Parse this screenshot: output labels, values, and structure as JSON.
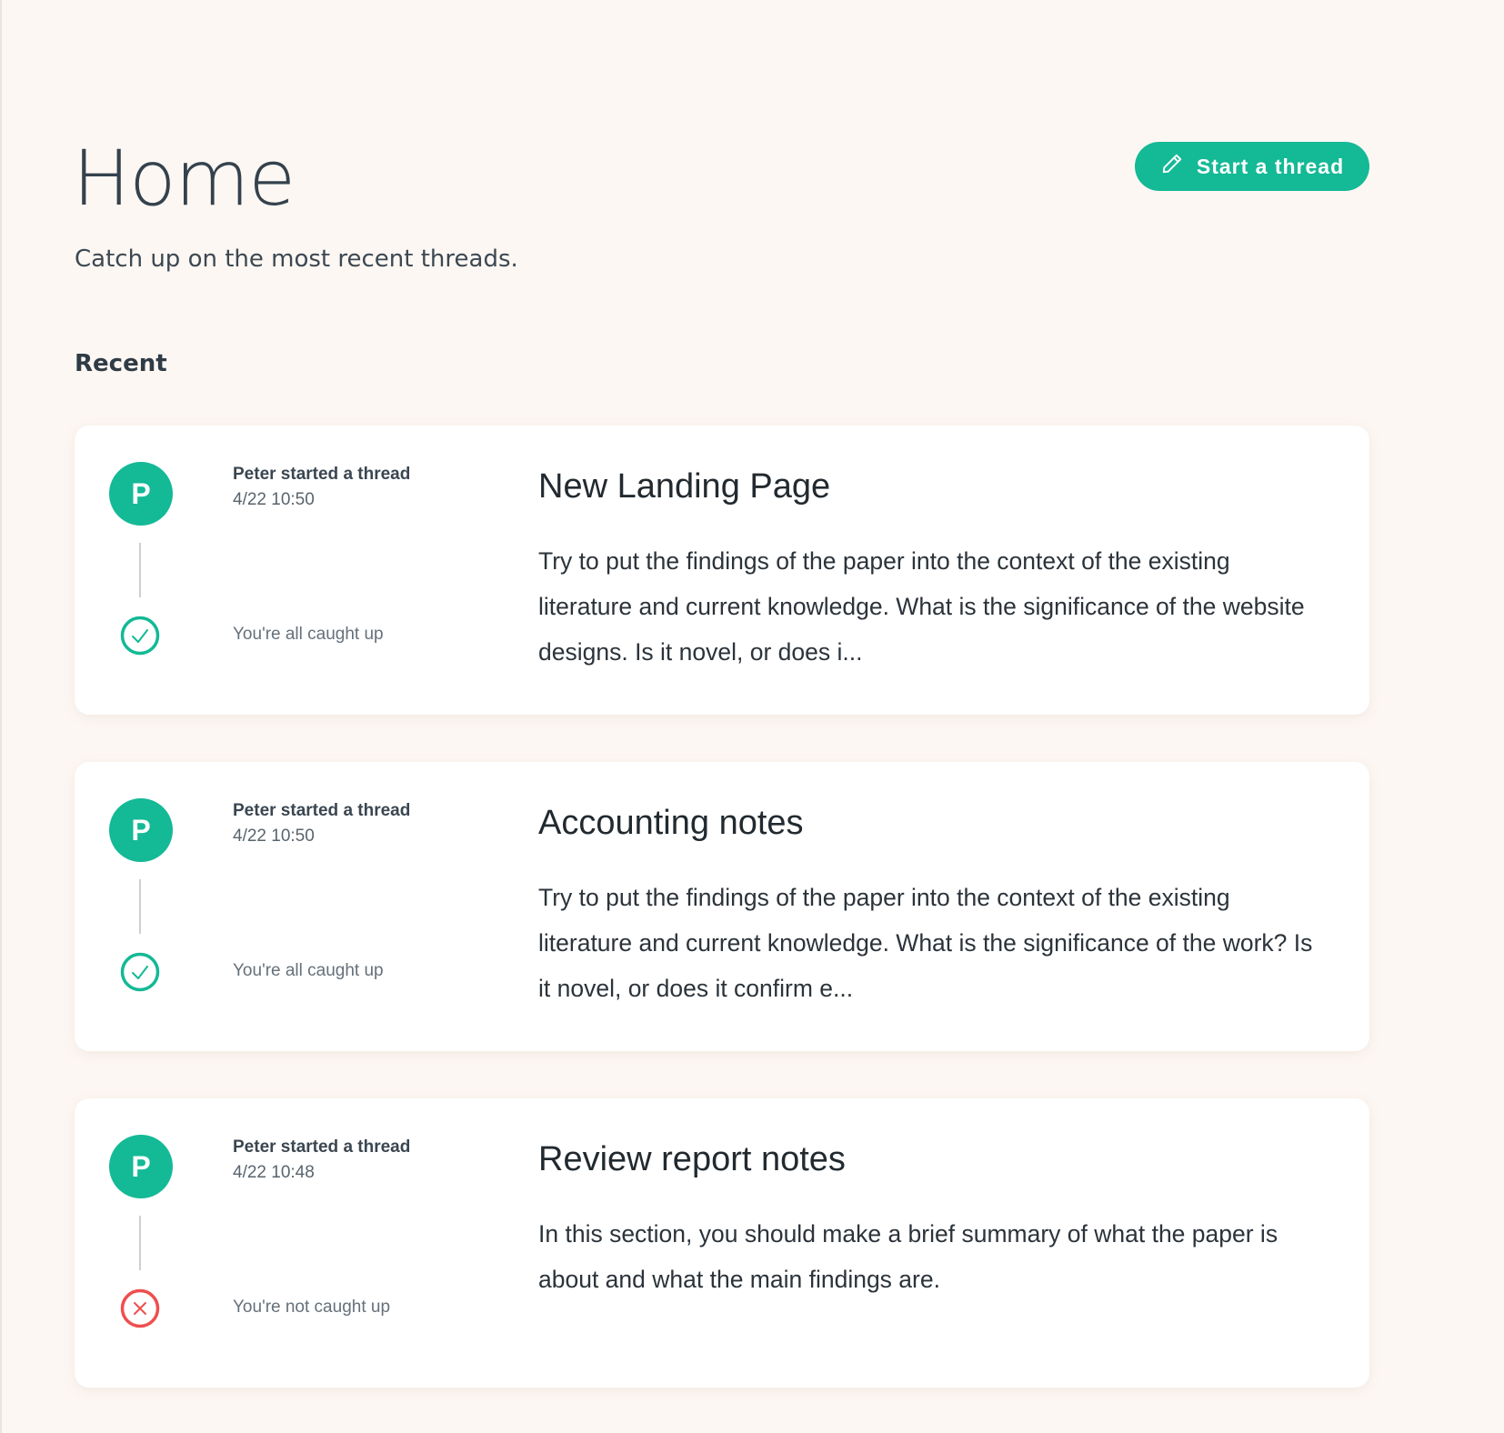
{
  "page": {
    "title": "Home",
    "subtitle": "Catch up on the most recent threads.",
    "section_title": "Recent"
  },
  "actions": {
    "start_thread_label": "Start a thread",
    "start_thread_icon": "pencil-icon"
  },
  "colors": {
    "accent": "#14b996",
    "error": "#ef4e4e",
    "background": "#fdf7f3"
  },
  "threads": [
    {
      "avatar_initial": "P",
      "author_line": "Peter started a thread",
      "timestamp": "4/22 10:50",
      "status": "caught-up",
      "status_text": "You're all caught up",
      "title": "New Landing Page",
      "excerpt": "Try to put the findings of the paper into the context of the existing literature and current knowledge. What is the significance of the website designs. Is it novel, or does i..."
    },
    {
      "avatar_initial": "P",
      "author_line": "Peter started a thread",
      "timestamp": "4/22 10:50",
      "status": "caught-up",
      "status_text": "You're all caught up",
      "title": "Accounting notes",
      "excerpt": "Try to put the findings of the paper into the context of the existing literature and current knowledge. What is the significance of the work? Is it novel, or does it confirm e..."
    },
    {
      "avatar_initial": "P",
      "author_line": "Peter started a thread",
      "timestamp": "4/22 10:48",
      "status": "not-caught-up",
      "status_text": "You're not caught up",
      "title": "Review report notes",
      "excerpt": "In this section, you should make a brief summary of what the paper is about and what the main findings are."
    }
  ]
}
